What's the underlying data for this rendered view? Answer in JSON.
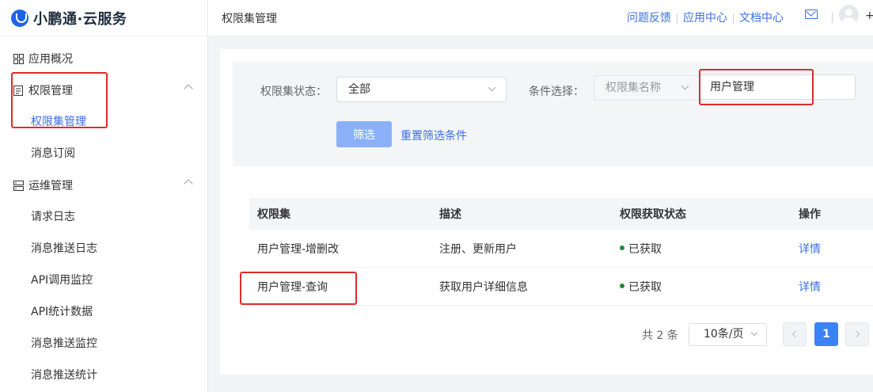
{
  "brand": {
    "name": "小鹏通·云服务"
  },
  "sidebar": {
    "overview": "应用概况",
    "groups": [
      {
        "label": "权限管理",
        "items": [
          "权限集管理",
          "消息订阅"
        ]
      },
      {
        "label": "运维管理",
        "items": [
          "请求日志",
          "消息推送日志",
          "API调用监控",
          "API统计数据",
          "消息推送监控",
          "消息推送统计"
        ]
      }
    ]
  },
  "header": {
    "page_title": "权限集管理",
    "links": [
      "问题反馈",
      "应用中心",
      "文档中心"
    ],
    "plus": "+"
  },
  "filters": {
    "status_label": "权限集状态：",
    "status_value": "全部",
    "condition_label": "条件选择：",
    "condition_type": "权限集名称",
    "condition_value": "用户管理",
    "submit_label": "筛选",
    "reset_label": "重置筛选条件"
  },
  "table": {
    "columns": [
      "权限集",
      "描述",
      "权限获取状态",
      "操作"
    ],
    "rows": [
      {
        "name": "用户管理-增删改",
        "desc": "注册、更新用户",
        "status": "已获取",
        "action": "详情"
      },
      {
        "name": "用户管理-查询",
        "desc": "获取用户详细信息",
        "status": "已获取",
        "action": "详情"
      }
    ]
  },
  "pagination": {
    "total": "共 2 条",
    "page_size": "10条/页",
    "current": "1"
  },
  "colors": {
    "accent": "#3b6fe8",
    "annotation": "#e02a2a",
    "status_ok": "#1f8a3b"
  }
}
